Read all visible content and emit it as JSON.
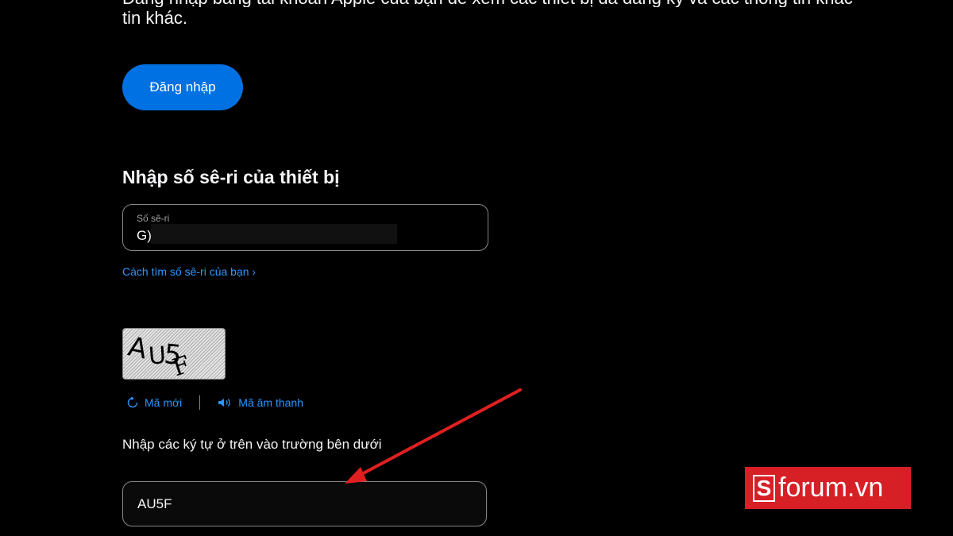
{
  "intro": {
    "line_cut": "Đăng nhập bằng tài khoản Apple của bạn để xem các thiết bị đã đăng ký và các thông tin khác",
    "tail": "tin khác."
  },
  "signin": {
    "label": "Đăng nhập"
  },
  "serial_section": {
    "title": "Nhập số sê-ri của thiết bị",
    "field_label": "Số sê-ri",
    "field_value": "G)",
    "find_link": "Cách tìm số sê-ri của bạn ›"
  },
  "captcha": {
    "chars": [
      "A",
      "U",
      "5",
      "F"
    ],
    "new_code_label": "Mã mới",
    "audio_code_label": "Mã âm thanh",
    "instruction": "Nhập các ký tự ở trên vào trường bên dưới",
    "input_value": "AU5F"
  },
  "watermark": {
    "logo_letter": "S",
    "text": "forum.vn"
  },
  "colors": {
    "accent": "#0071e3",
    "link": "#2997ff",
    "arrow": "#e02020",
    "watermark": "#d71f26"
  }
}
